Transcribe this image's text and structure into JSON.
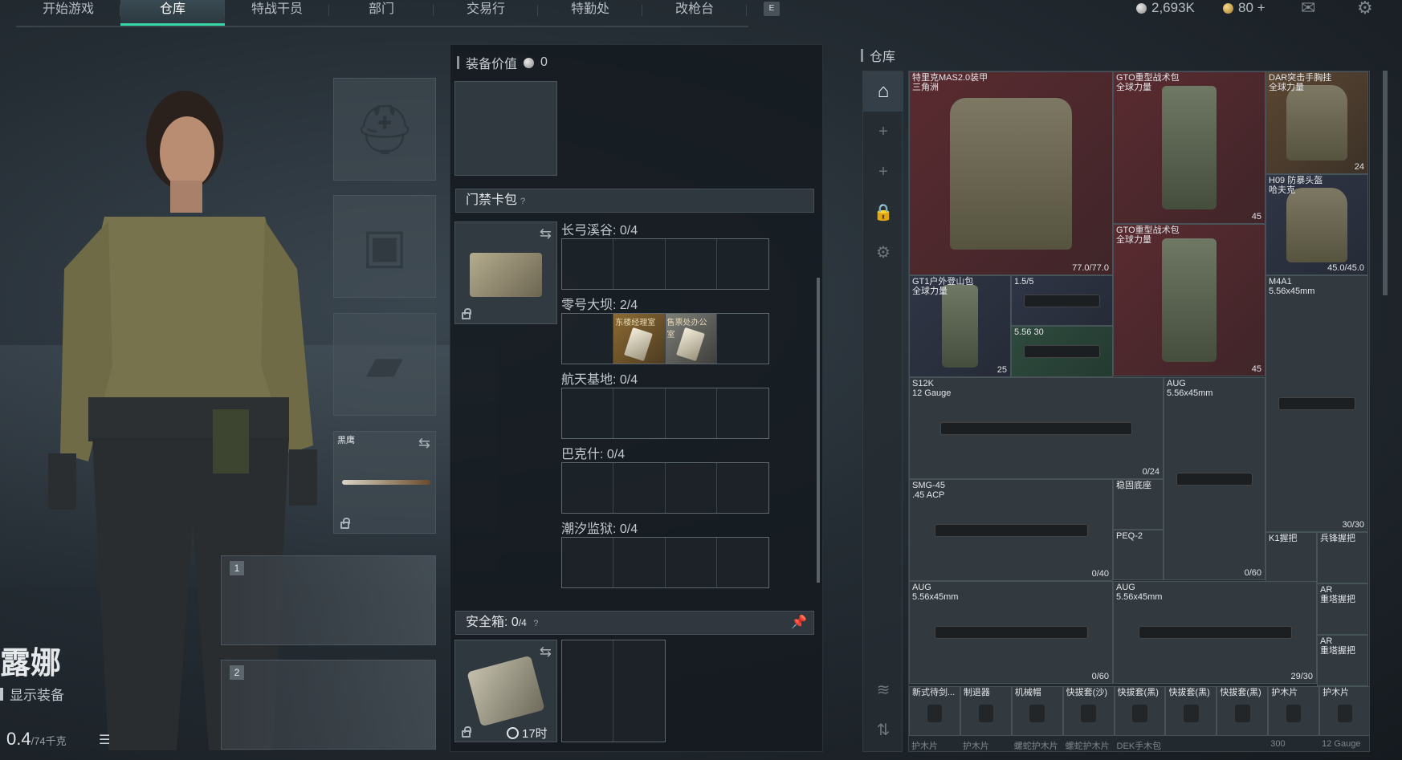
{
  "nav": {
    "tabs": [
      "开始游戏",
      "仓库",
      "特战干员",
      "部门",
      "交易行",
      "特勤处",
      "改枪台"
    ],
    "active": "仓库",
    "hint_key": "E"
  },
  "currency": {
    "silver": "2,693K",
    "gold": "80 +"
  },
  "character": {
    "name": "露娜",
    "show_equipment": "显示装备",
    "weight": "0.4",
    "weight_max": "/74千克"
  },
  "equipment": {
    "melee_name": "黑鹰",
    "weapon_slot_1": "1",
    "weapon_slot_2": "2"
  },
  "middle": {
    "value_label": "装备价值",
    "value": "0",
    "card_pack_label": "门禁卡包",
    "help": "?",
    "maps": [
      {
        "name": "长弓溪谷: 0/4"
      },
      {
        "name": "零号大坝: 2/4",
        "cards": [
          "东楼经理室",
          "售票处办公室"
        ]
      },
      {
        "name": "航天基地: 0/4"
      },
      {
        "name": "巴克什: 0/4"
      },
      {
        "name": "潮汐监狱: 0/4"
      }
    ],
    "safe_box_label": "安全箱:",
    "safe_box_value": "0",
    "safe_box_max": "/4",
    "safe_timer": "17时"
  },
  "storage": {
    "title": "仓库",
    "items": [
      {
        "name": "特里克MAS2.0装甲\n三角洲",
        "count": "77.0/77.0",
        "color": "red",
        "art": "vest"
      },
      {
        "name": "GTO重型战术包\n全球力量",
        "count": "45",
        "color": "red",
        "art": "pack"
      },
      {
        "name": "DAR突击手胸挂\n全球力量",
        "count": "24",
        "color": "gold",
        "art": "vest"
      },
      {
        "name": "H09 防暴头盔\n哈夫克",
        "count": "45.0/45.0",
        "color": "blue",
        "art": "vest"
      },
      {
        "name": "GTO重型战术包\n全球力量",
        "count": "45",
        "color": "red",
        "art": "pack"
      },
      {
        "name": "GT1户外登山包\n全球力量",
        "count": "25",
        "color": "blue",
        "art": "pack"
      },
      {
        "name": "1.5/5",
        "count": "",
        "color": "blue",
        "art": "gun"
      },
      {
        "name": "5.56 30",
        "count": "",
        "color": "grn",
        "art": "gun"
      },
      {
        "name": "M4A1\n5.56x45mm",
        "count": "30/30",
        "color": "",
        "art": "gun"
      },
      {
        "name": "S12K\n12 Gauge",
        "count": "0/24",
        "color": "",
        "art": "gun"
      },
      {
        "name": "AUG\n5.56x45mm",
        "count": "0/60",
        "color": "",
        "art": "gun"
      },
      {
        "name": "SMG-45\n.45 ACP",
        "count": "0/40",
        "color": "",
        "art": "gun"
      },
      {
        "name": "稳固底座",
        "count": "",
        "color": "",
        "art": ""
      },
      {
        "name": "PEQ-2",
        "count": "",
        "color": "",
        "art": ""
      },
      {
        "name": "K1握把",
        "count": "",
        "color": "",
        "art": ""
      },
      {
        "name": "兵锋握把",
        "count": "",
        "color": "",
        "art": ""
      },
      {
        "name": "AUG\n5.56x45mm",
        "count": "0/60",
        "color": "",
        "art": "gun"
      },
      {
        "name": "AUG\n5.56x45mm",
        "count": "29/30",
        "color": "",
        "art": "gun"
      },
      {
        "name": "AR\n重塔握把",
        "count": "",
        "color": "",
        "art": ""
      },
      {
        "name": "AR\n重塔握把",
        "count": "",
        "color": "",
        "art": ""
      }
    ],
    "bottom_row": [
      "新式待剑...",
      "制退器",
      "机械帽",
      "快拔套(沙)",
      "快拔套(黑)",
      "快拔套(黑)",
      "快拔套(黑)",
      "护木片",
      "护木片"
    ],
    "bottom_row2": [
      "护木片",
      "护木片",
      "螺蛇护木片",
      "螺蛇护木片",
      "DEK手木包",
      "",
      "",
      "300",
      "12 Gauge"
    ]
  }
}
